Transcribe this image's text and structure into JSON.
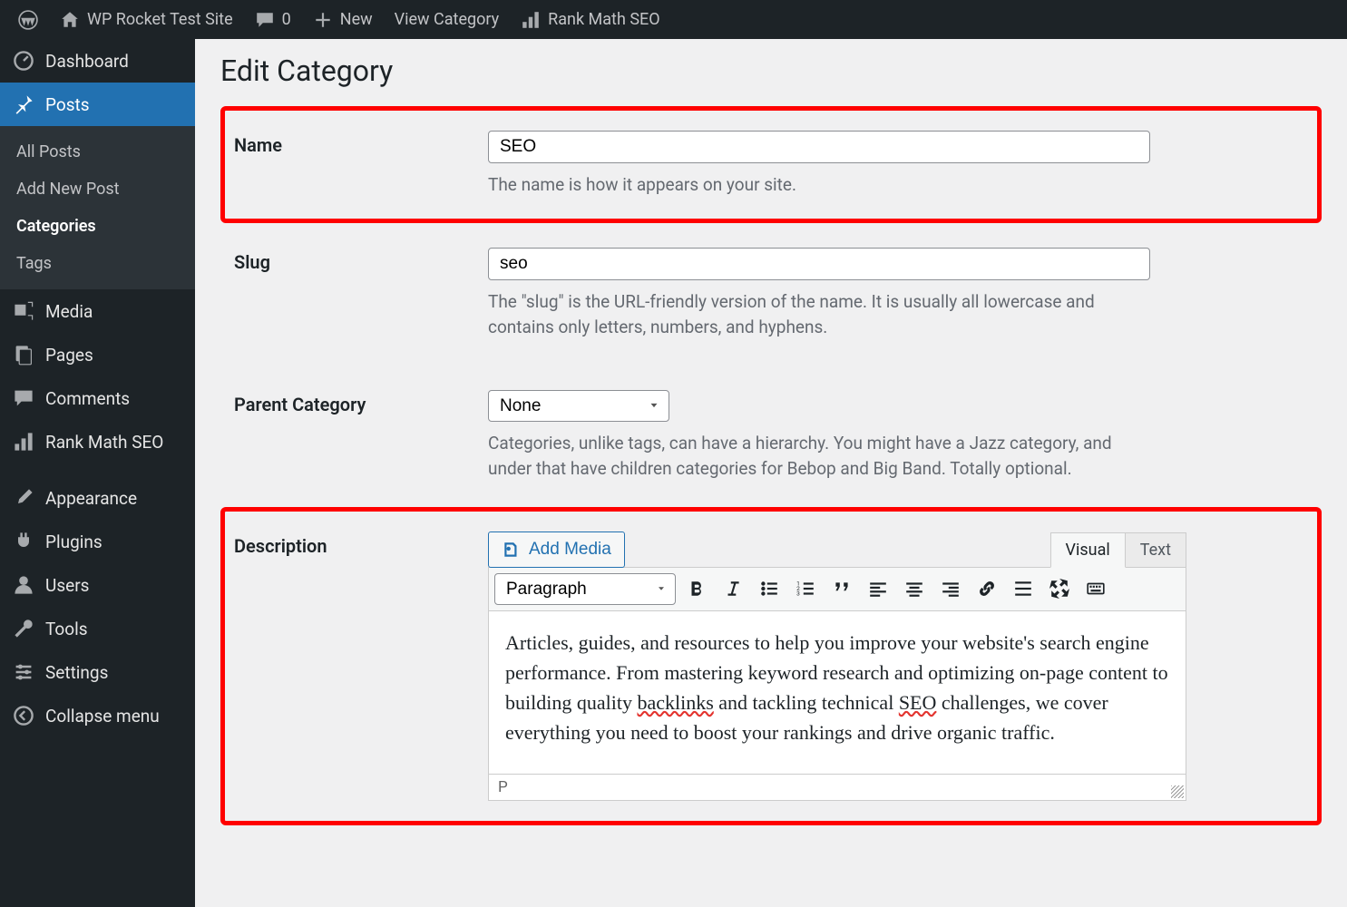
{
  "adminbar": {
    "site_title": "WP Rocket Test Site",
    "comments_count": "0",
    "new_label": "New",
    "view_label": "View Category",
    "rank_math_label": "Rank Math SEO"
  },
  "sidebar": {
    "dashboard": "Dashboard",
    "posts": "Posts",
    "submenu": {
      "all_posts": "All Posts",
      "add_new": "Add New Post",
      "categories": "Categories",
      "tags": "Tags"
    },
    "media": "Media",
    "pages": "Pages",
    "comments": "Comments",
    "rank_math": "Rank Math SEO",
    "appearance": "Appearance",
    "plugins": "Plugins",
    "users": "Users",
    "tools": "Tools",
    "settings": "Settings",
    "collapse": "Collapse menu"
  },
  "page": {
    "title": "Edit Category",
    "name_label": "Name",
    "name_value": "SEO",
    "name_desc": "The name is how it appears on your site.",
    "slug_label": "Slug",
    "slug_value": "seo",
    "slug_desc": "The \"slug\" is the URL-friendly version of the name. It is usually all lowercase and contains only letters, numbers, and hyphens.",
    "parent_label": "Parent Category",
    "parent_value": "None",
    "parent_desc": "Categories, unlike tags, can have a hierarchy. You might have a Jazz category, and under that have children categories for Bebop and Big Band. Totally optional.",
    "desc_label": "Description",
    "add_media": "Add Media",
    "tab_visual": "Visual",
    "tab_text": "Text",
    "format_select": "Paragraph",
    "desc_before_sp1": "Articles, guides, and resources to help you improve your website's search engine performance. From mastering keyword research and optimizing on-page content to building quality ",
    "desc_sp1": "backlinks",
    "desc_between": " and tackling technical ",
    "desc_sp2": "SEO",
    "desc_after_sp2": " challenges, we cover everything you need to boost your rankings and drive organic traffic.",
    "status_path": "P"
  }
}
